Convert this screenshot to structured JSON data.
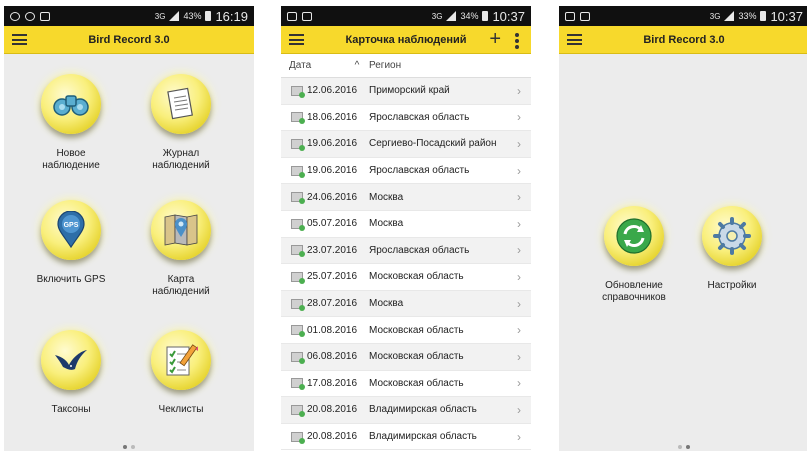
{
  "screen1": {
    "status": {
      "battery": "43%",
      "net": "3G",
      "time": "16:19"
    },
    "title": "Bird Record 3.0",
    "tiles": [
      {
        "label": "Новое\nнаблюдение",
        "icon": "binoculars-icon"
      },
      {
        "label": "Журнал\nнаблюдений",
        "icon": "notebook-icon"
      },
      {
        "label": "Включить GPS",
        "icon": "gps-pin-icon",
        "gps_text": "GPS"
      },
      {
        "label": "Карта\nнаблюдений",
        "icon": "map-icon"
      },
      {
        "label": "Таксоны",
        "icon": "bird-icon"
      },
      {
        "label": "Чеклисты",
        "icon": "checklist-icon"
      }
    ]
  },
  "screen2": {
    "status": {
      "battery": "34%",
      "net": "3G",
      "time": "10:37"
    },
    "title": "Карточка наблюдений",
    "plus": "+",
    "headers": {
      "date": "Дата",
      "sort": "^",
      "region": "Регион"
    },
    "rows": [
      {
        "date": "12.06.2016",
        "region": "Приморский край"
      },
      {
        "date": "18.06.2016",
        "region": "Ярославская область"
      },
      {
        "date": "19.06.2016",
        "region": "Сергиево-Посадский район"
      },
      {
        "date": "19.06.2016",
        "region": "Ярославская область"
      },
      {
        "date": "24.06.2016",
        "region": "Москва"
      },
      {
        "date": "05.07.2016",
        "region": "Москва"
      },
      {
        "date": "23.07.2016",
        "region": "Ярославская область"
      },
      {
        "date": "25.07.2016",
        "region": "Московская область"
      },
      {
        "date": "28.07.2016",
        "region": "Москва"
      },
      {
        "date": "01.08.2016",
        "region": "Московская область"
      },
      {
        "date": "06.08.2016",
        "region": "Московская область"
      },
      {
        "date": "17.08.2016",
        "region": "Московская область"
      },
      {
        "date": "20.08.2016",
        "region": "Владимирская область"
      },
      {
        "date": "20.08.2016",
        "region": "Владимирская область"
      }
    ]
  },
  "screen3": {
    "status": {
      "battery": "33%",
      "net": "3G",
      "time": "10:37"
    },
    "title": "Bird Record 3.0",
    "tiles": [
      {
        "label": "Обновление\nсправочников",
        "icon": "refresh-icon"
      },
      {
        "label": "Настройки",
        "icon": "gear-icon"
      }
    ]
  },
  "colors": {
    "accent": "#f7d92c",
    "statusbar": "#101010"
  }
}
